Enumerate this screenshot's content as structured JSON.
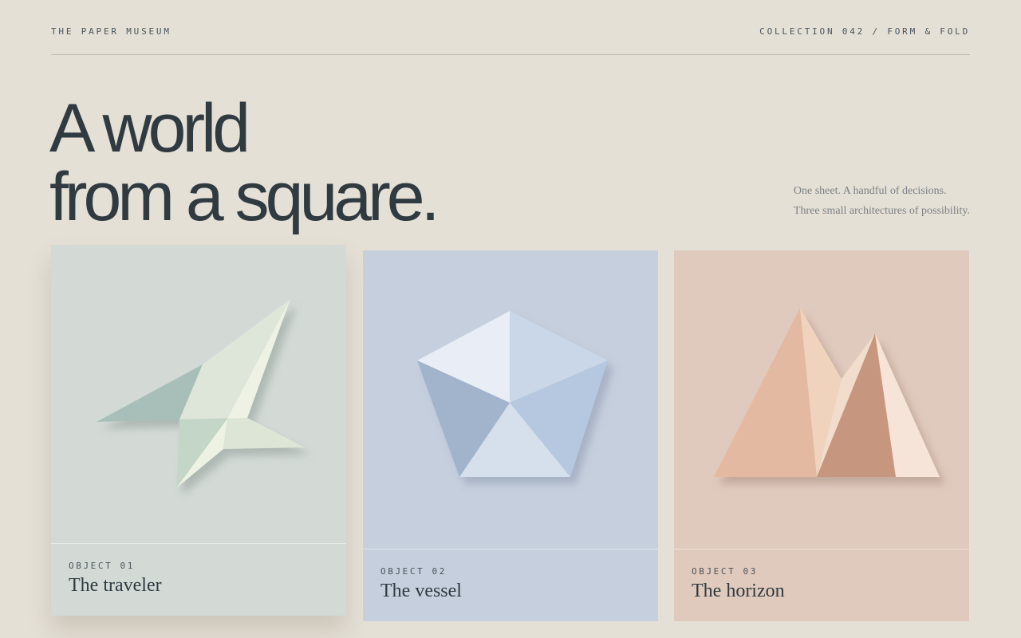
{
  "header": {
    "brand": "THE PAPER MUSEUM",
    "collection": "COLLECTION 042 / FORM & FOLD"
  },
  "hero": {
    "line1": "A world",
    "line2": "from a square."
  },
  "tagline": {
    "line1": "One sheet. A handful of decisions.",
    "line2": "Three small architectures of possibility."
  },
  "objects": [
    {
      "number": "OBJECT 01",
      "title": "The traveler",
      "shape": "paper-plane",
      "background": "#d3dad6"
    },
    {
      "number": "OBJECT 02",
      "title": "The vessel",
      "shape": "pentagon",
      "background": "#c6cfdd"
    },
    {
      "number": "OBJECT 03",
      "title": "The horizon",
      "shape": "mountains",
      "background": "#e0cabd"
    }
  ]
}
